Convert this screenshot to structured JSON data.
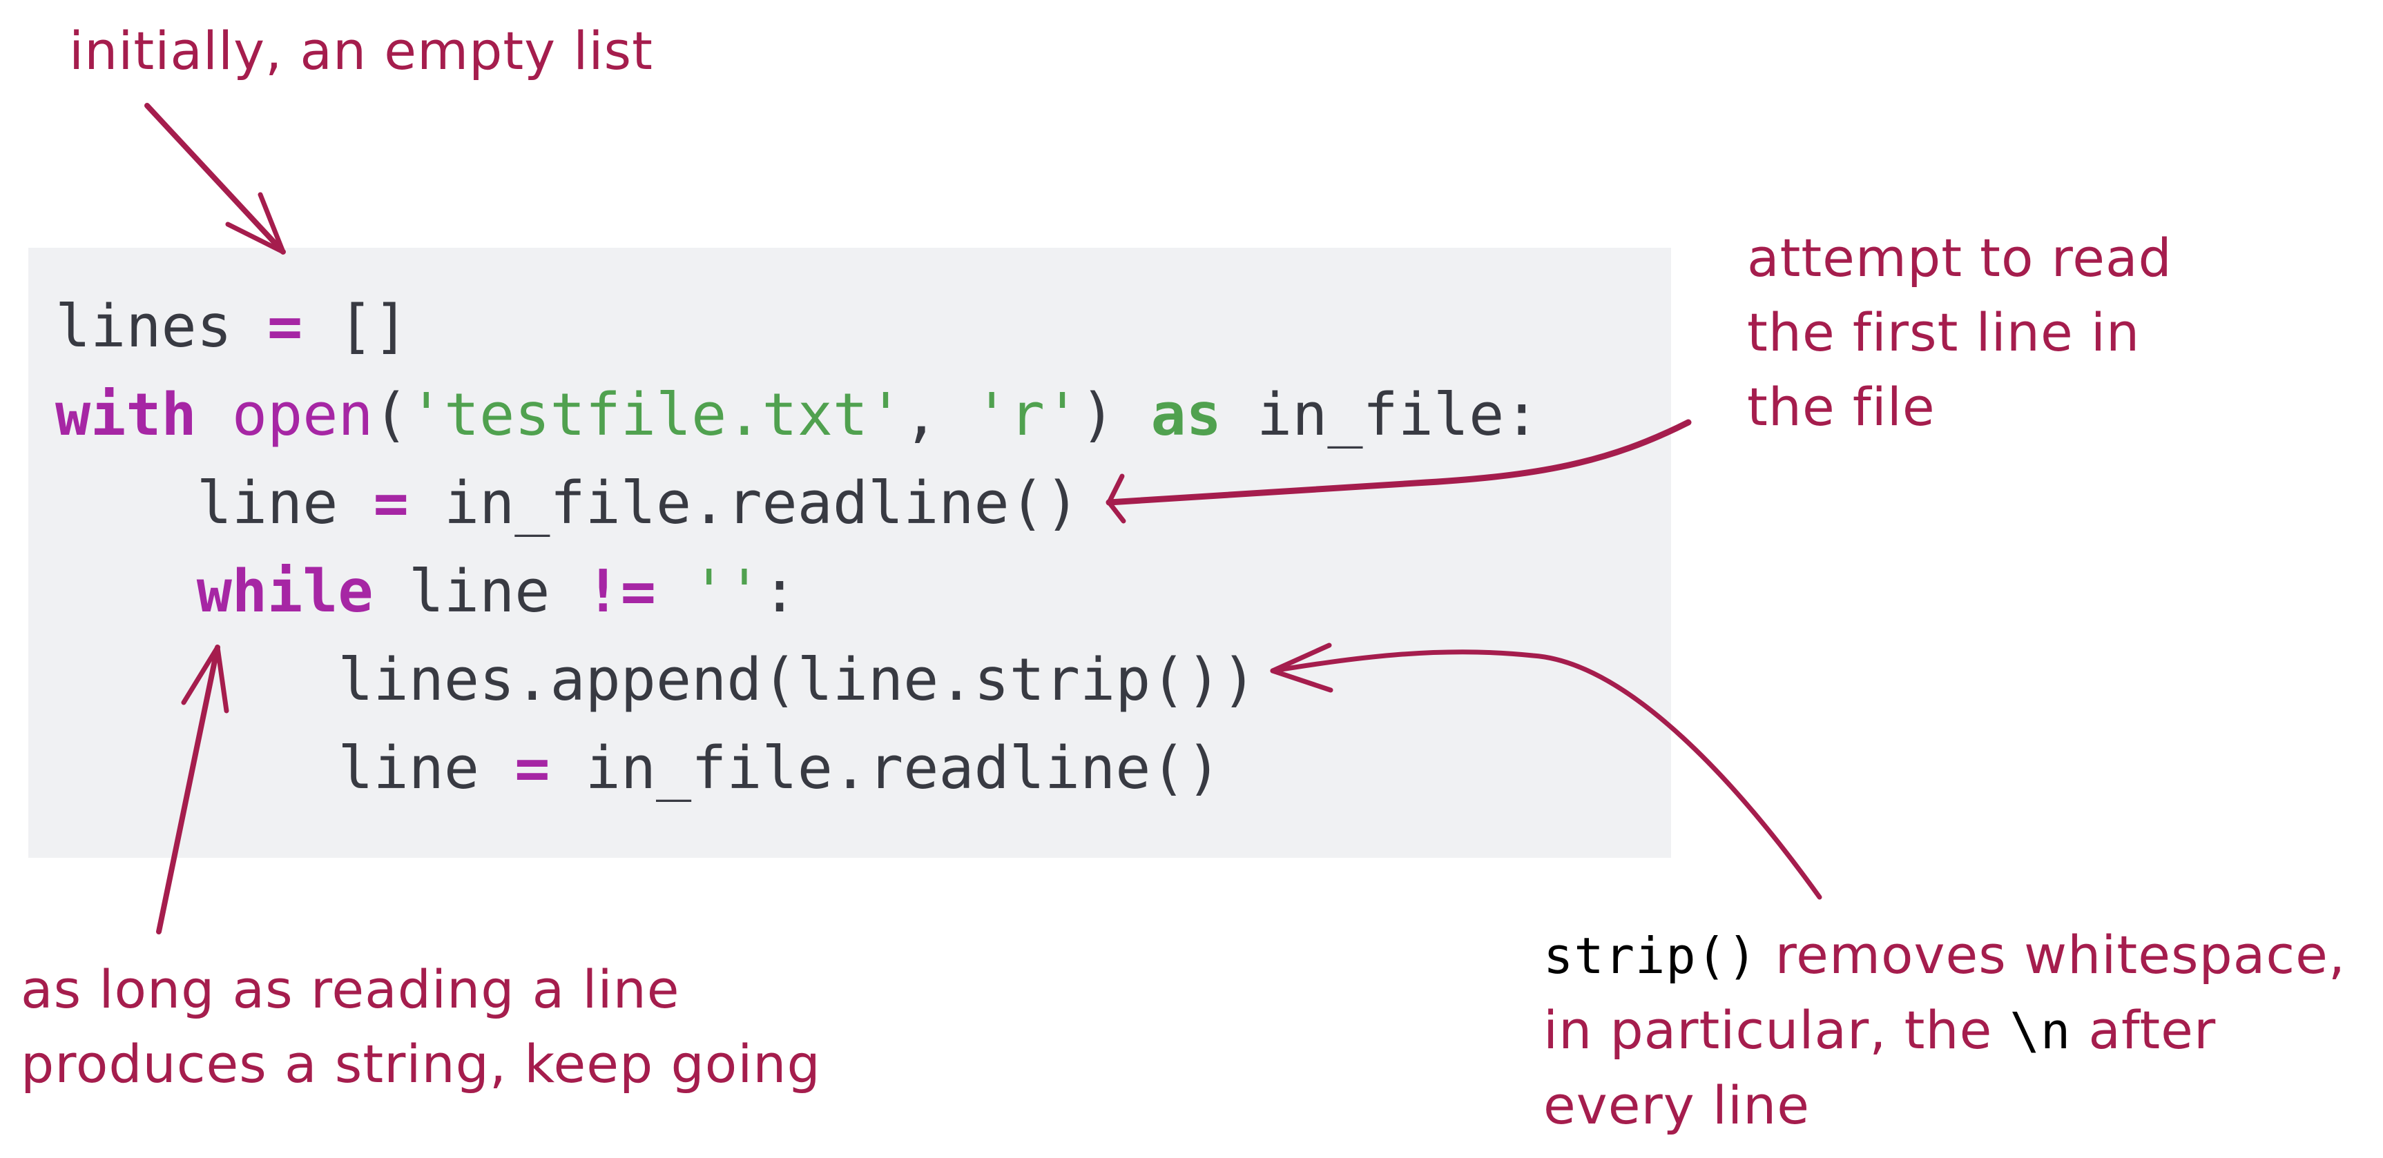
{
  "accent_color": "#a51d4d",
  "code": {
    "language": "python",
    "lines": [
      [
        {
          "t": "lines ",
          "c": "plain"
        },
        {
          "t": "=",
          "c": "op"
        },
        {
          "t": " []",
          "c": "plain"
        }
      ],
      [
        {
          "t": "with",
          "c": "kw"
        },
        {
          "t": " ",
          "c": "plain"
        },
        {
          "t": "open",
          "c": "fn"
        },
        {
          "t": "(",
          "c": "plain"
        },
        {
          "t": "'testfile.txt'",
          "c": "str"
        },
        {
          "t": ", ",
          "c": "plain"
        },
        {
          "t": "'r'",
          "c": "str"
        },
        {
          "t": ") ",
          "c": "plain"
        },
        {
          "t": "as",
          "c": "kw2"
        },
        {
          "t": " in_file:",
          "c": "plain"
        }
      ],
      [
        {
          "t": "    line ",
          "c": "plain"
        },
        {
          "t": "=",
          "c": "op"
        },
        {
          "t": " in_file.readline()",
          "c": "plain"
        }
      ],
      [
        {
          "t": "    ",
          "c": "plain"
        },
        {
          "t": "while",
          "c": "kw"
        },
        {
          "t": " line ",
          "c": "plain"
        },
        {
          "t": "!=",
          "c": "op"
        },
        {
          "t": " ",
          "c": "plain"
        },
        {
          "t": "''",
          "c": "str"
        },
        {
          "t": ":",
          "c": "plain"
        }
      ],
      [
        {
          "t": "        lines.append(line.strip())",
          "c": "plain"
        }
      ],
      [
        {
          "t": "        line ",
          "c": "plain"
        },
        {
          "t": "=",
          "c": "op"
        },
        {
          "t": " in_file.readline()",
          "c": "plain"
        }
      ]
    ]
  },
  "annotations": {
    "empty_list": {
      "text": "initially, an empty list"
    },
    "first_line": {
      "lines": [
        "attempt to read",
        "the first line in",
        "the file"
      ]
    },
    "loop": {
      "lines": [
        "as long as reading a line",
        "produces a string, keep going"
      ]
    },
    "strip": {
      "code_term": "strip()",
      "line1_rest": "removes whitespace,",
      "line2_pre": "in particular, the",
      "line2_code": "\\n",
      "line2_post": "after",
      "line3": "every line"
    }
  }
}
